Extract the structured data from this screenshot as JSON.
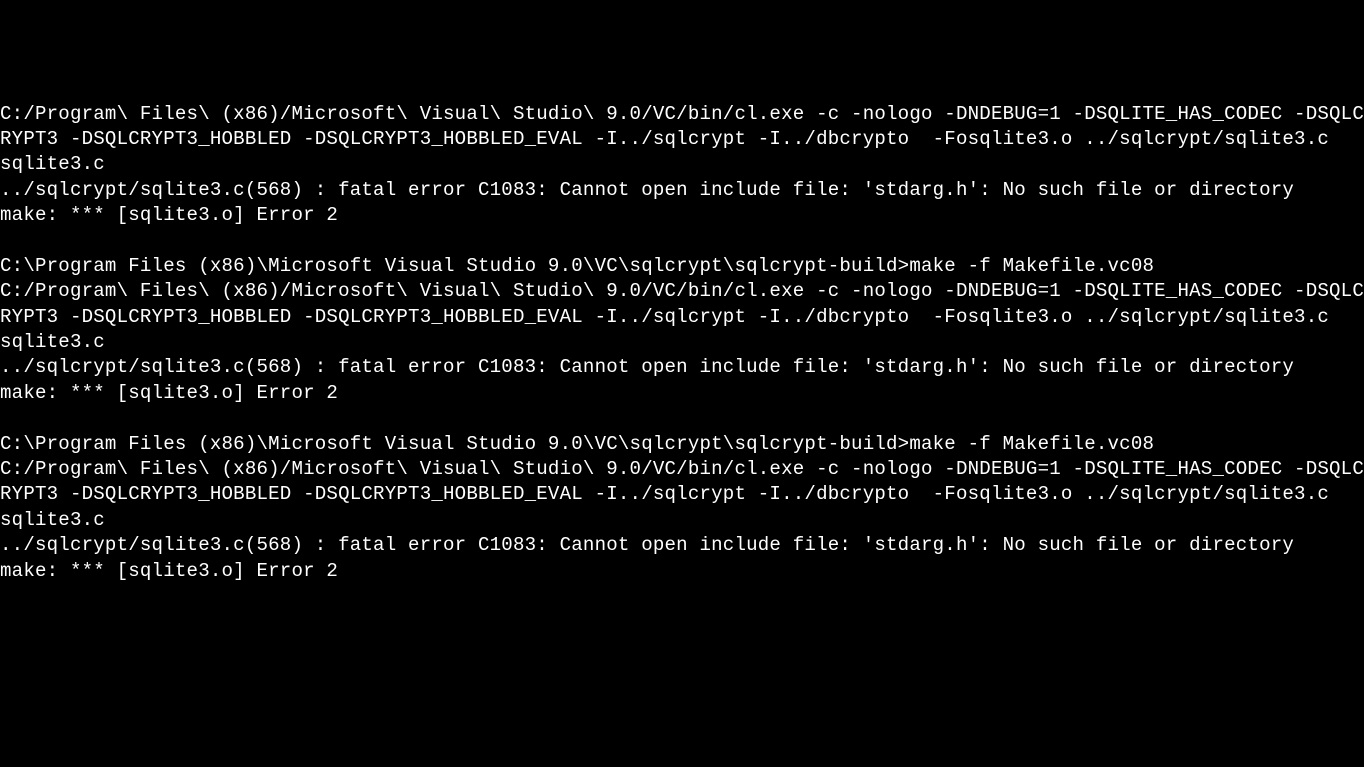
{
  "terminal": {
    "lines": [
      "C:/Program\\ Files\\ (x86)/Microsoft\\ Visual\\ Studio\\ 9.0/VC/bin/cl.exe -c -nologo -DNDEBUG=1 -DSQLITE_HAS_CODEC -DSQLCRYPT3 -DSQLCRYPT3_HOBBLED -DSQLCRYPT3_HOBBLED_EVAL -I../sqlcrypt -I../dbcrypto  -Fosqlite3.o ../sqlcrypt/sqlite3.c",
      "sqlite3.c",
      "../sqlcrypt/sqlite3.c(568) : fatal error C1083: Cannot open include file: 'stdarg.h': No such file or directory",
      "make: *** [sqlite3.o] Error 2",
      "",
      "C:\\Program Files (x86)\\Microsoft Visual Studio 9.0\\VC\\sqlcrypt\\sqlcrypt-build>make -f Makefile.vc08",
      "C:/Program\\ Files\\ (x86)/Microsoft\\ Visual\\ Studio\\ 9.0/VC/bin/cl.exe -c -nologo -DNDEBUG=1 -DSQLITE_HAS_CODEC -DSQLCRYPT3 -DSQLCRYPT3_HOBBLED -DSQLCRYPT3_HOBBLED_EVAL -I../sqlcrypt -I../dbcrypto  -Fosqlite3.o ../sqlcrypt/sqlite3.c",
      "sqlite3.c",
      "../sqlcrypt/sqlite3.c(568) : fatal error C1083: Cannot open include file: 'stdarg.h': No such file or directory",
      "make: *** [sqlite3.o] Error 2",
      "",
      "C:\\Program Files (x86)\\Microsoft Visual Studio 9.0\\VC\\sqlcrypt\\sqlcrypt-build>make -f Makefile.vc08",
      "C:/Program\\ Files\\ (x86)/Microsoft\\ Visual\\ Studio\\ 9.0/VC/bin/cl.exe -c -nologo -DNDEBUG=1 -DSQLITE_HAS_CODEC -DSQLCRYPT3 -DSQLCRYPT3_HOBBLED -DSQLCRYPT3_HOBBLED_EVAL -I../sqlcrypt -I../dbcrypto  -Fosqlite3.o ../sqlcrypt/sqlite3.c",
      "sqlite3.c",
      "../sqlcrypt/sqlite3.c(568) : fatal error C1083: Cannot open include file: 'stdarg.h': No such file or directory",
      "make: *** [sqlite3.o] Error 2"
    ]
  }
}
